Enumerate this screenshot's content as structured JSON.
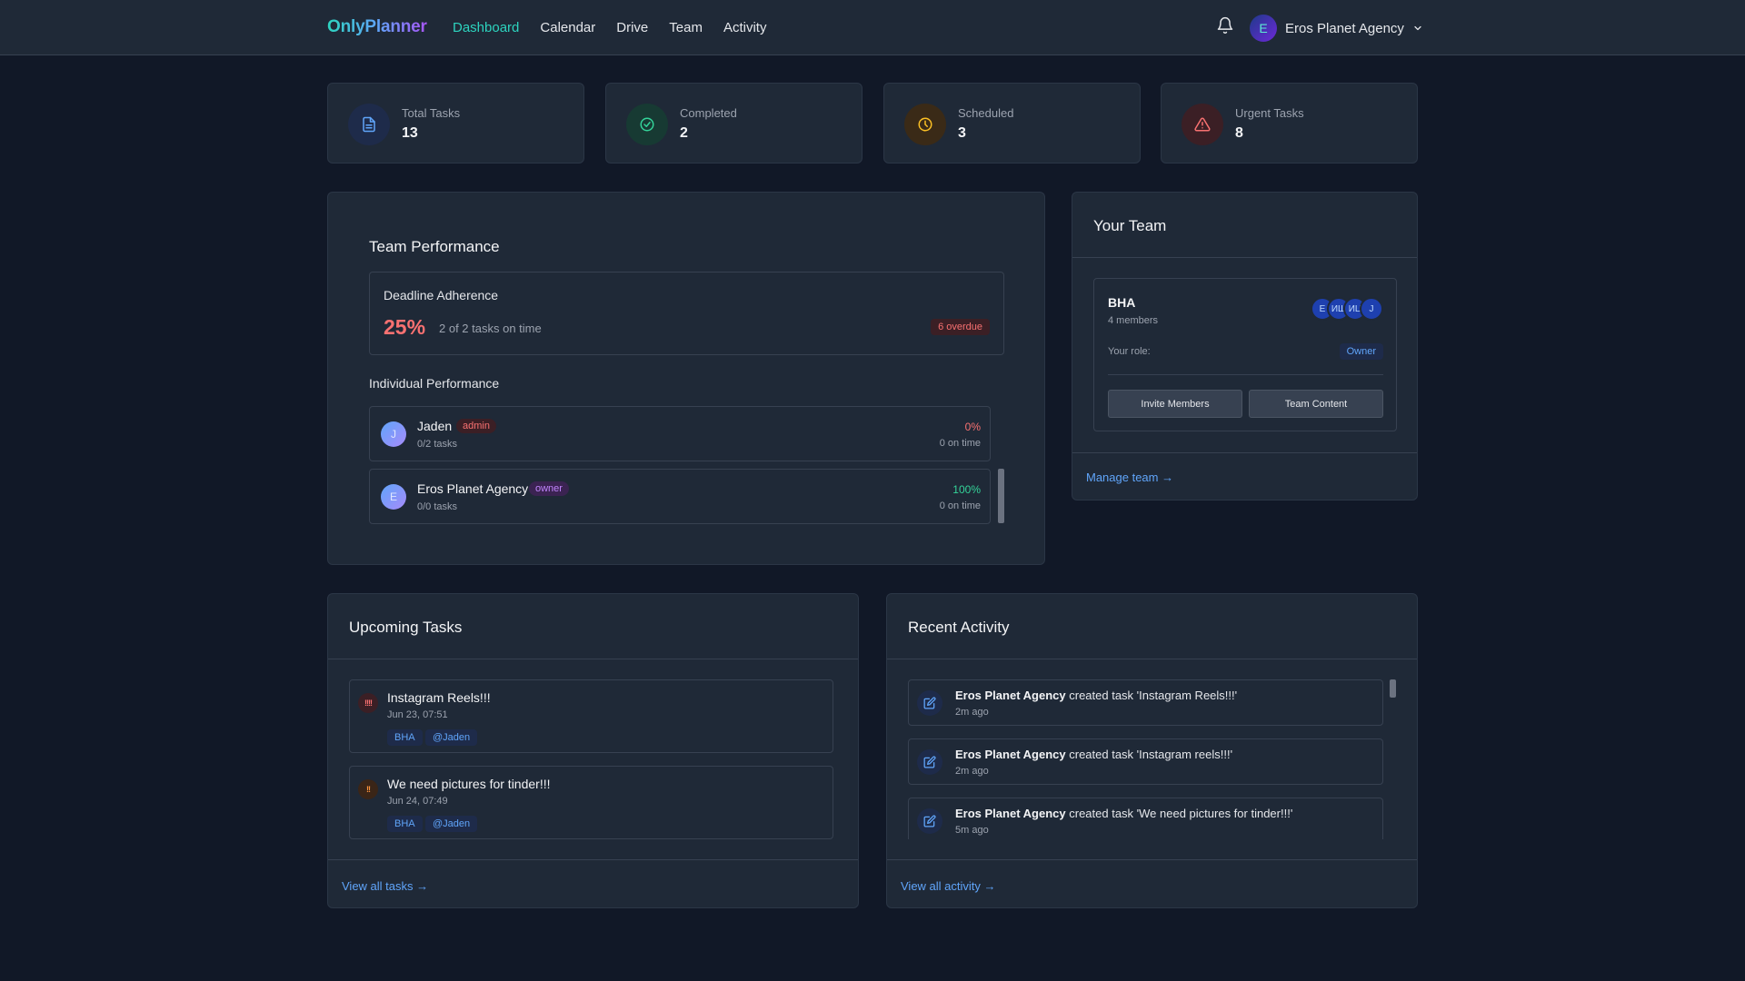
{
  "app": {
    "logo": "OnlyPlanner",
    "nav": [
      {
        "label": "Dashboard",
        "active": true
      },
      {
        "label": "Calendar",
        "active": false
      },
      {
        "label": "Drive",
        "active": false
      },
      {
        "label": "Team",
        "active": false
      },
      {
        "label": "Activity",
        "active": false
      }
    ],
    "user": {
      "initial": "E",
      "name": "Eros Planet Agency"
    },
    "icons": {
      "notifications": "bell-icon",
      "user_menu": "chevron-down-icon"
    }
  },
  "stats": [
    {
      "label": "Total Tasks",
      "value": "13",
      "icon": "document-icon",
      "color": "#60a5fa"
    },
    {
      "label": "Completed",
      "value": "2",
      "icon": "check-circle-icon",
      "color": "#34d399"
    },
    {
      "label": "Scheduled",
      "value": "3",
      "icon": "clock-icon",
      "color": "#fbbf24"
    },
    {
      "label": "Urgent Tasks",
      "value": "8",
      "icon": "warning-icon",
      "color": "#f87171"
    }
  ],
  "performance": {
    "title": "Team Performance",
    "deadline": {
      "title": "Deadline Adherence",
      "percent": "25%",
      "description": "2 of 2 tasks on time",
      "overdue": "6 overdue"
    },
    "individual_title": "Individual Performance",
    "members": [
      {
        "initial": "J",
        "name": "Jaden",
        "role": "admin",
        "tasks": "0/2 tasks",
        "percent": "0%",
        "on_time": "0 on time",
        "percent_color": "#f87171"
      },
      {
        "initial": "E",
        "name": "Eros Planet Agency",
        "role": "owner",
        "tasks": "0/0 tasks",
        "percent": "100%",
        "on_time": "0 on time",
        "percent_color": "#34d399"
      }
    ]
  },
  "team": {
    "title": "Your Team",
    "name": "BHA",
    "members_count": "4 members",
    "avatars": [
      "E",
      "ИШ",
      "ИЦ",
      "J"
    ],
    "role_label": "Your role:",
    "role": "Owner",
    "invite_label": "Invite Members",
    "content_label": "Team Content",
    "manage_link": "Manage team →"
  },
  "upcoming": {
    "title": "Upcoming Tasks",
    "tasks": [
      {
        "priority": "!!!!",
        "title": "Instagram Reels!!!",
        "date": "Jun 23, 07:51",
        "tags": [
          "BHA",
          "@Jaden"
        ]
      },
      {
        "priority": "!!",
        "title": "We need pictures for tinder!!!",
        "date": "Jun 24, 07:49",
        "tags": [
          "BHA",
          "@Jaden"
        ]
      }
    ],
    "view_all": "View all tasks →"
  },
  "activity": {
    "title": "Recent Activity",
    "items": [
      {
        "actor": "Eros Planet Agency",
        "action": " created task 'Instagram Reels!!!'",
        "time": "2m ago"
      },
      {
        "actor": "Eros Planet Agency",
        "action": " created task 'Instagram reels!!!'",
        "time": "2m ago"
      },
      {
        "actor": "Eros Planet Agency",
        "action": " created task 'We need pictures for tinder!!!'",
        "time": "5m ago"
      }
    ],
    "view_all": "View all activity →"
  }
}
